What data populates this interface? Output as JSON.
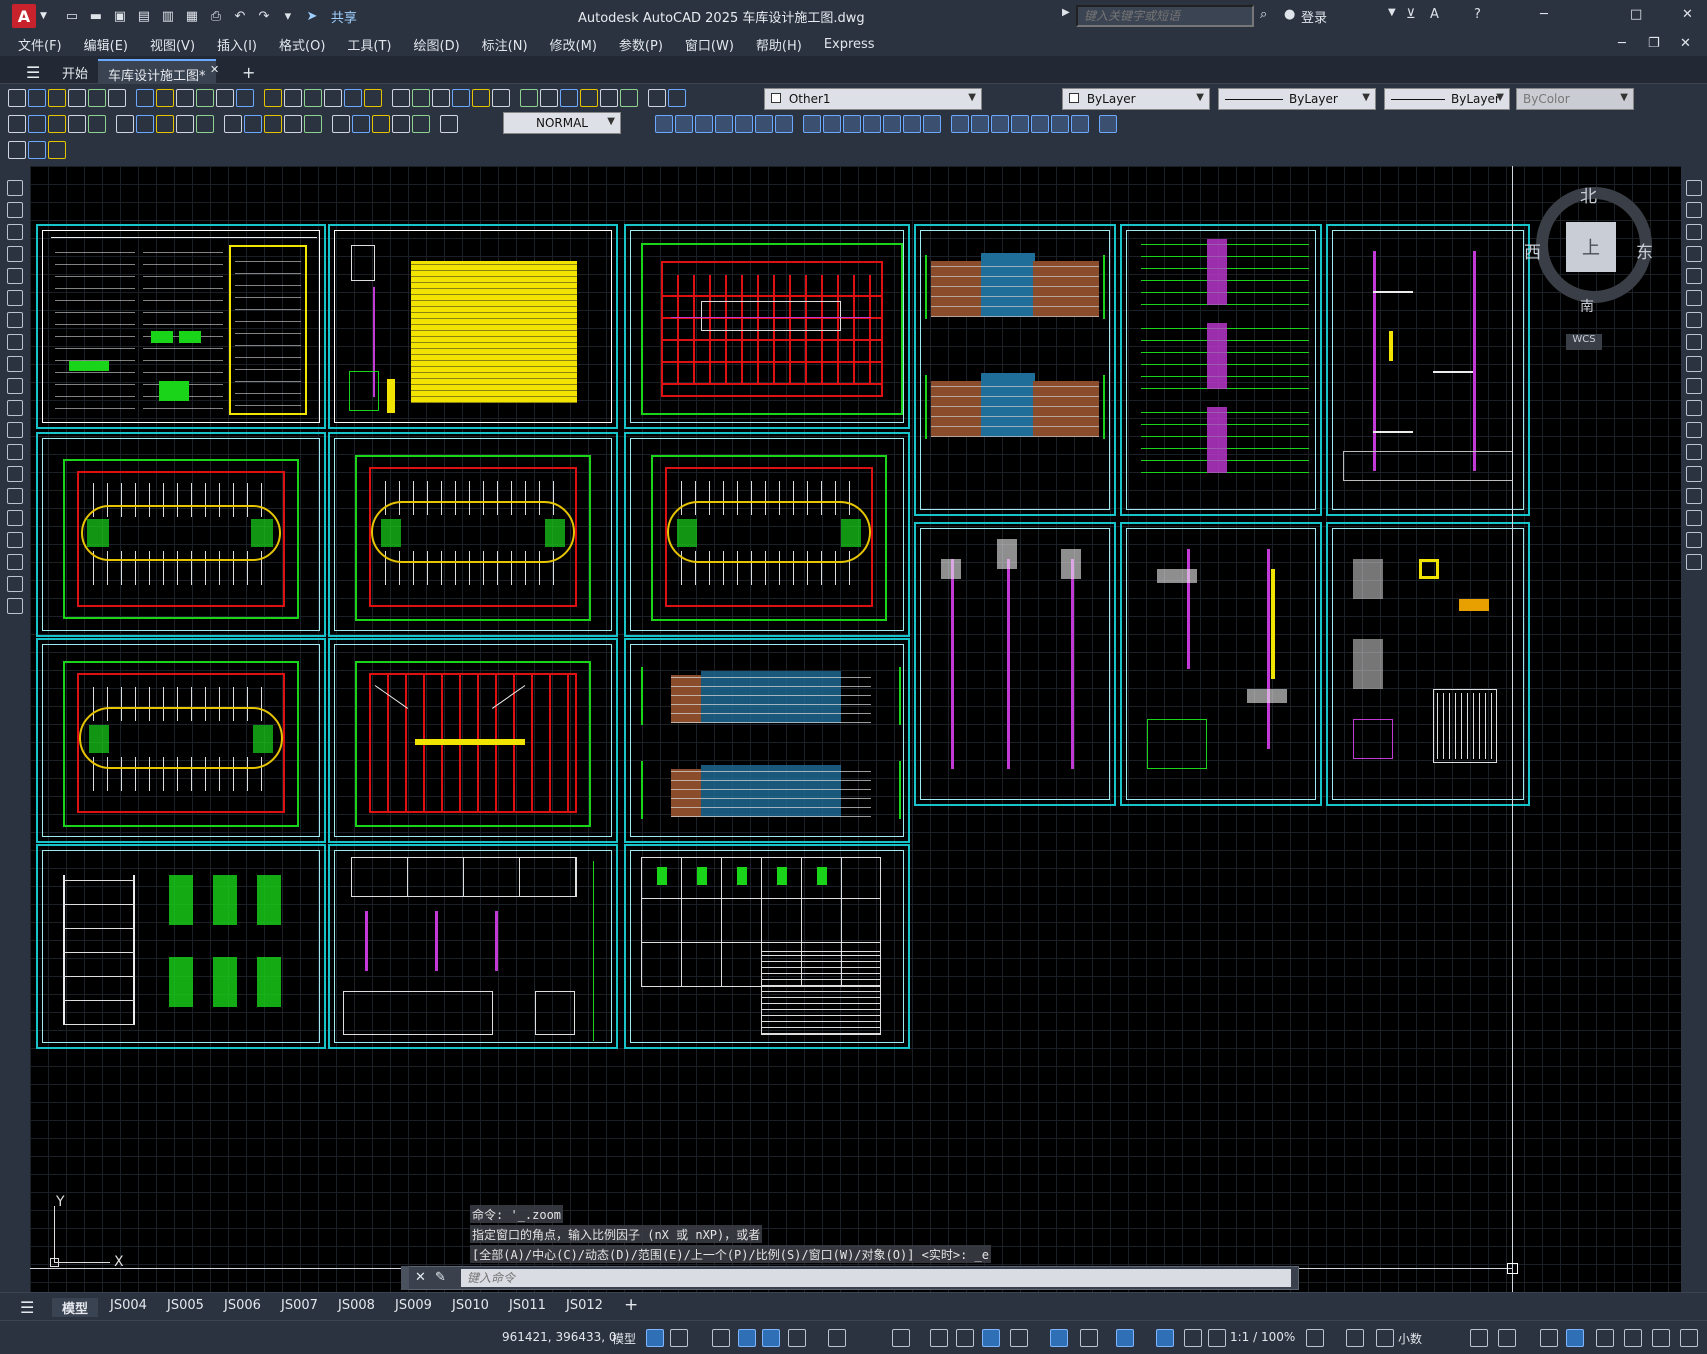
{
  "titlebar": {
    "app_logo": "A",
    "share": "共享",
    "title": "Autodesk AutoCAD 2025    车库设计施工图.dwg",
    "search_placeholder": "键入关键字或短语",
    "login": "登录"
  },
  "menu": [
    "文件(F)",
    "编辑(E)",
    "视图(V)",
    "插入(I)",
    "格式(O)",
    "工具(T)",
    "绘图(D)",
    "标注(N)",
    "修改(M)",
    "参数(P)",
    "窗口(W)",
    "帮助(H)",
    "Express"
  ],
  "filetabs": {
    "start": "开始",
    "active": "车库设计施工图*"
  },
  "toolbar": {
    "layer": "Other1",
    "color": "ByLayer",
    "linetype": "ByLayer",
    "lineweight": "ByLayer",
    "plotstyle": "ByColor",
    "dimstyle": "NORMAL"
  },
  "viewcube": {
    "north": "北",
    "south": "南",
    "east": "东",
    "west": "西",
    "top": "上",
    "wcs": "WCS"
  },
  "ucs": {
    "x": "X",
    "y": "Y"
  },
  "command": {
    "history": [
      "命令: '_.zoom",
      "指定窗口的角点，输入比例因子 (nX 或 nXP)，或者",
      "[全部(A)/中心(C)/动态(D)/范围(E)/上一个(P)/比例(S)/窗口(W)/对象(O)] <实时>: _e"
    ],
    "placeholder": "键入命令"
  },
  "layouts": [
    "模型",
    "JS004",
    "JS005",
    "JS006",
    "JS007",
    "JS008",
    "JS009",
    "JS010",
    "JS011",
    "JS012"
  ],
  "status": {
    "coords": "961421, 396433, 0",
    "mode": "模型",
    "scale": "1:1 / 100%",
    "units": "小数"
  }
}
